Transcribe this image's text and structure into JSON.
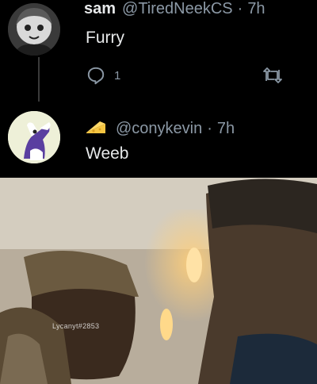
{
  "tweets": [
    {
      "name": "sam",
      "handle": "@TiredNeekCS",
      "separator": "·",
      "time": "7h",
      "text": "Furry",
      "reply_count": "1"
    },
    {
      "name_icon": "cheese-icon",
      "handle": "@conykevin",
      "separator": "·",
      "time": "7h",
      "text": "Weeb"
    }
  ],
  "video": {
    "watermark": "Lycanyt#2853"
  },
  "colors": {
    "background": "#000000",
    "text": "#e7e9ea",
    "secondary": "#8b98a5"
  }
}
